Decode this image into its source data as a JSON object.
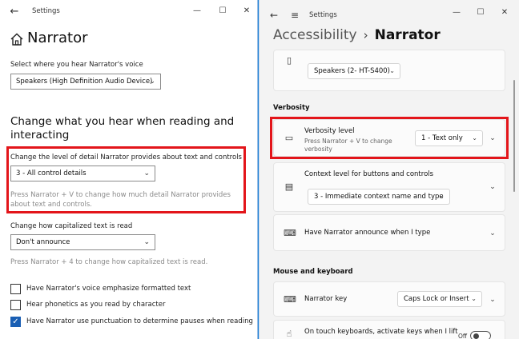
{
  "left": {
    "app_title": "Settings",
    "page_title": "Narrator",
    "voice_label": "Select where you hear Narrator's voice",
    "voice_value": "Speakers (High Definition Audio Device)",
    "section_title": "Change what you hear when reading and interacting",
    "detail_label": "Change the level of detail Narrator provides about text and controls",
    "detail_value": "3 - All control details",
    "detail_hint": "Press Narrator + V to change how much detail Narrator provides about text and controls.",
    "caps_label": "Change how capitalized text is read",
    "caps_value": "Don't announce",
    "caps_hint": "Press Narrator + 4 to change how capitalized text is read.",
    "checkboxes": [
      {
        "label": "Have Narrator's voice emphasize formatted text",
        "checked": false
      },
      {
        "label": "Hear phonetics as you read by character",
        "checked": false
      },
      {
        "label": "Have Narrator use punctuation to determine pauses when reading",
        "checked": true
      }
    ]
  },
  "right": {
    "app_title": "Settings",
    "breadcrumb_parent": "Accessibility",
    "breadcrumb_separator": "›",
    "breadcrumb_current": "Narrator",
    "speakers_value": "Speakers (2- HT-S400)",
    "verbosity_section": "Verbosity",
    "verbosity_title": "Verbosity level",
    "verbosity_sub": "Press Narrator + V to change verbosity",
    "verbosity_value": "1 - Text only",
    "context_title": "Context level for buttons and controls",
    "context_value": "3 - Immediate context name and type",
    "announce_title": "Have Narrator announce when I type",
    "mouse_section": "Mouse and keyboard",
    "narrator_key_title": "Narrator key",
    "narrator_key_value": "Caps Lock or Insert",
    "touch_title": "On touch keyboards, activate keys when I lift",
    "toggle_state": "Off"
  },
  "colors": {
    "highlight": "#e3151a",
    "accent": "#1a5fb4",
    "desktop": "#1a7fd6"
  }
}
